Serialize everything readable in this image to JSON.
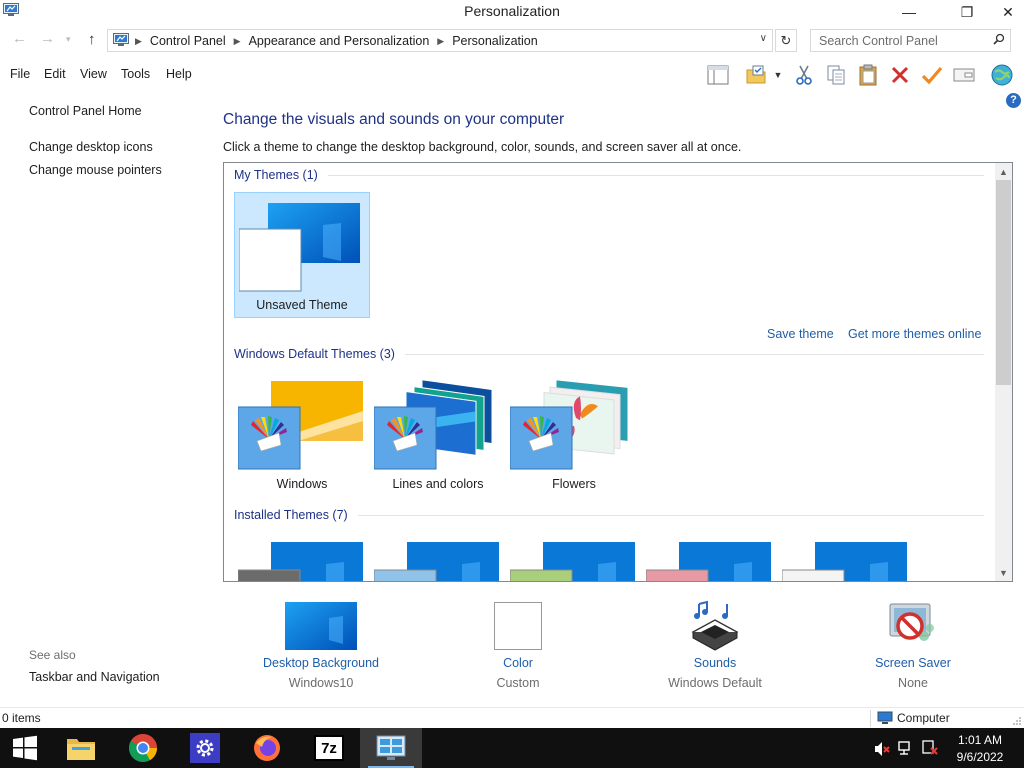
{
  "window": {
    "title": "Personalization",
    "minimize_icon": "—",
    "maximize_icon": "❐",
    "close_icon": "✕"
  },
  "address": {
    "crumbs": [
      "Control Panel",
      "Appearance and Personalization",
      "Personalization"
    ],
    "search_placeholder": "Search Control Panel"
  },
  "menu": {
    "file": "File",
    "edit": "Edit",
    "view": "View",
    "tools": "Tools",
    "help": "Help"
  },
  "left_pane": {
    "home": "Control Panel Home",
    "desktop_icons": "Change desktop icons",
    "mouse_pointers": "Change mouse pointers",
    "see_also": "See also",
    "taskbar_nav": "Taskbar and Navigation"
  },
  "main": {
    "title": "Change the visuals and sounds on your computer",
    "description": "Click a theme to change the desktop background, color, sounds, and screen saver all at once.",
    "groups": {
      "my_themes": "My Themes (1)",
      "default_themes": "Windows Default Themes (3)",
      "installed_themes": "Installed Themes (7)"
    },
    "my_themes": [
      {
        "label": "Unsaved Theme",
        "selected": true
      }
    ],
    "default_themes": [
      {
        "label": "Windows"
      },
      {
        "label": "Lines and colors"
      },
      {
        "label": "Flowers"
      }
    ],
    "installed_theme_swatch_colors": [
      "#6b6b6b",
      "#8fc3ea",
      "#a9cf7b",
      "#e89aa4",
      "#f4f4f4"
    ],
    "save_theme": "Save theme",
    "get_more_themes": "Get more themes online"
  },
  "settings": [
    {
      "title": "Desktop Background",
      "value": "Windows10",
      "icon": "desktop-background-icon"
    },
    {
      "title": "Color",
      "value": "Custom",
      "icon": "color-icon"
    },
    {
      "title": "Sounds",
      "value": "Windows Default",
      "icon": "sounds-icon"
    },
    {
      "title": "Screen Saver",
      "value": "None",
      "icon": "screen-saver-icon"
    }
  ],
  "status": {
    "items": "0 items",
    "location": "Computer"
  },
  "taskbar": {
    "apps": [
      "file-explorer",
      "chrome",
      "settings",
      "firefox",
      "7zip",
      "control-panel"
    ],
    "time": "1:01 AM",
    "date": "9/6/2022"
  },
  "colors": {
    "link": "#1f5ea8",
    "heading": "#1e3287",
    "selection": "#cce8ff",
    "windows_blue": "#0a78d7"
  }
}
